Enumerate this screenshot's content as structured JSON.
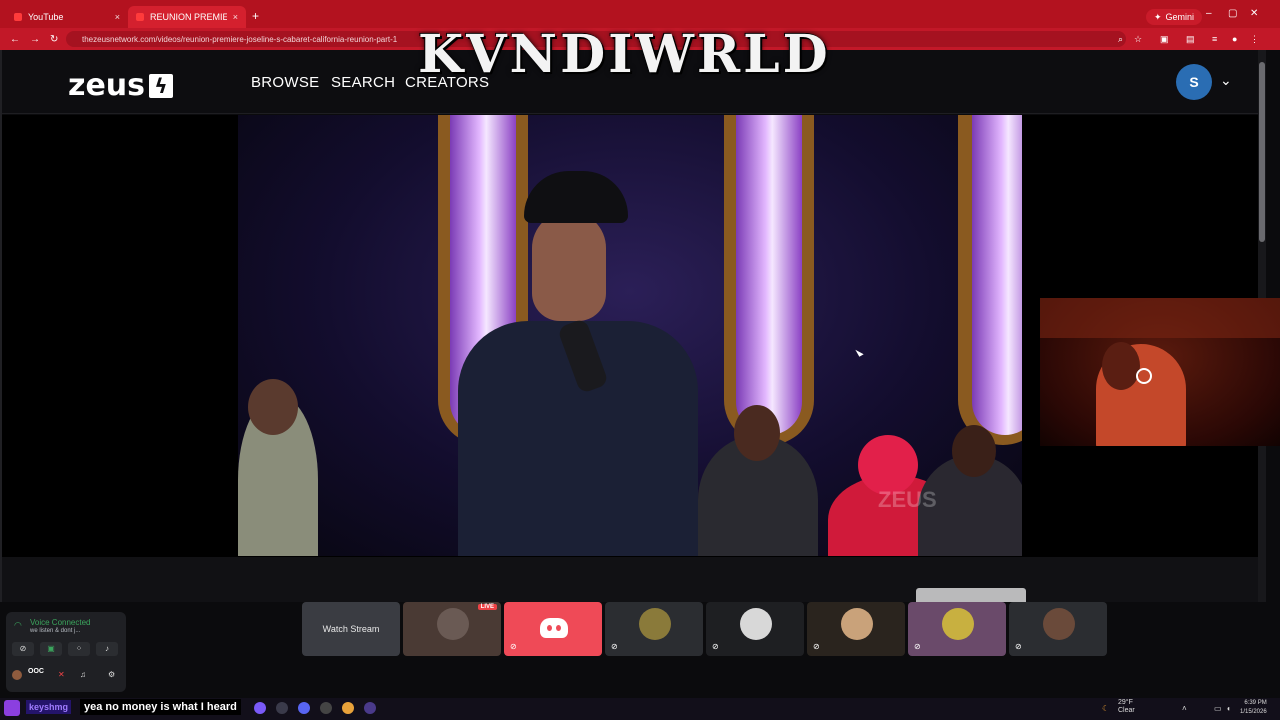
{
  "browser": {
    "tabs": [
      {
        "label": "YouTube",
        "close": "×"
      },
      {
        "label": "REUNION PREMIERE Joseline's",
        "close": "×"
      }
    ],
    "new_tab": "+",
    "gemini_label": "Gemini",
    "url": "thezeusnetwork.com/videos/reunion-premiere-joseline-s-cabaret-california-reunion-part-1",
    "window_controls": [
      "–",
      "▢",
      "✕"
    ]
  },
  "site": {
    "logo": "zeus",
    "logo_mark": "ϟ",
    "nav": [
      "BROWSE",
      "SEARCH",
      "CREATORS"
    ],
    "avatar_initial": "S",
    "menu_chevron": "⌄"
  },
  "stream_overlay": {
    "title": "KVNDIWRLD"
  },
  "video": {
    "watermark": "ZEUS"
  },
  "discord": {
    "voice_status": "Voice Connected",
    "voice_channel": "we listen & dont j...",
    "user_name": "OOC",
    "tiles": [
      {
        "label": "Watch Stream",
        "kind": "watch"
      },
      {
        "label": "",
        "kind": "user",
        "live": "LIVE",
        "color": "#5a4a44"
      },
      {
        "label": "",
        "kind": "discord",
        "color": "#ef4a57"
      },
      {
        "label": "",
        "kind": "user",
        "color": "#8a7a3a"
      },
      {
        "label": "",
        "kind": "user",
        "color": "#d8d8d8"
      },
      {
        "label": "",
        "kind": "user",
        "color": "#c9a27a"
      },
      {
        "label": "",
        "kind": "user",
        "color": "#c8b040"
      },
      {
        "label": "",
        "kind": "user",
        "color": "#6a4a3a"
      }
    ]
  },
  "caption": {
    "name": "keyshmg",
    "text": "yea no money is what I heard"
  },
  "taskbar": {
    "weather_temp": "29°F",
    "weather_desc": "Clear",
    "time": "6:39 PM",
    "date": "1/15/2026"
  }
}
